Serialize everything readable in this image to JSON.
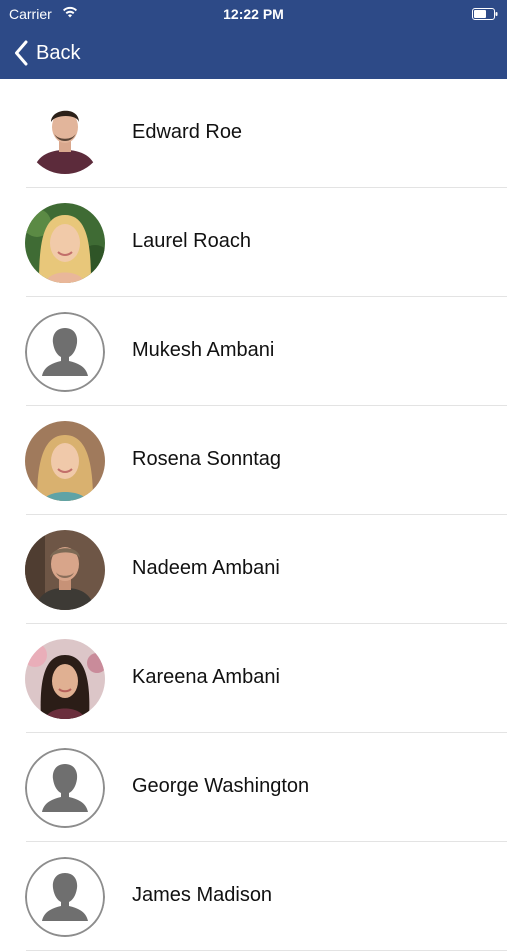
{
  "status_bar": {
    "carrier": "Carrier",
    "time": "12:22 PM",
    "wifi_icon": "wifi-icon",
    "battery_icon": "battery-icon"
  },
  "nav": {
    "back_label": "Back",
    "back_icon": "chevron-left-icon",
    "bar_color": "#2d4a87"
  },
  "contacts": [
    {
      "name": "Edward Roe",
      "avatar": "photo"
    },
    {
      "name": "Laurel Roach",
      "avatar": "photo"
    },
    {
      "name": "Mukesh Ambani",
      "avatar": "placeholder"
    },
    {
      "name": "Rosena Sonntag",
      "avatar": "photo"
    },
    {
      "name": "Nadeem Ambani",
      "avatar": "photo"
    },
    {
      "name": "Kareena Ambani",
      "avatar": "photo"
    },
    {
      "name": "George Washington",
      "avatar": "placeholder"
    },
    {
      "name": "James Madison",
      "avatar": "placeholder"
    }
  ]
}
